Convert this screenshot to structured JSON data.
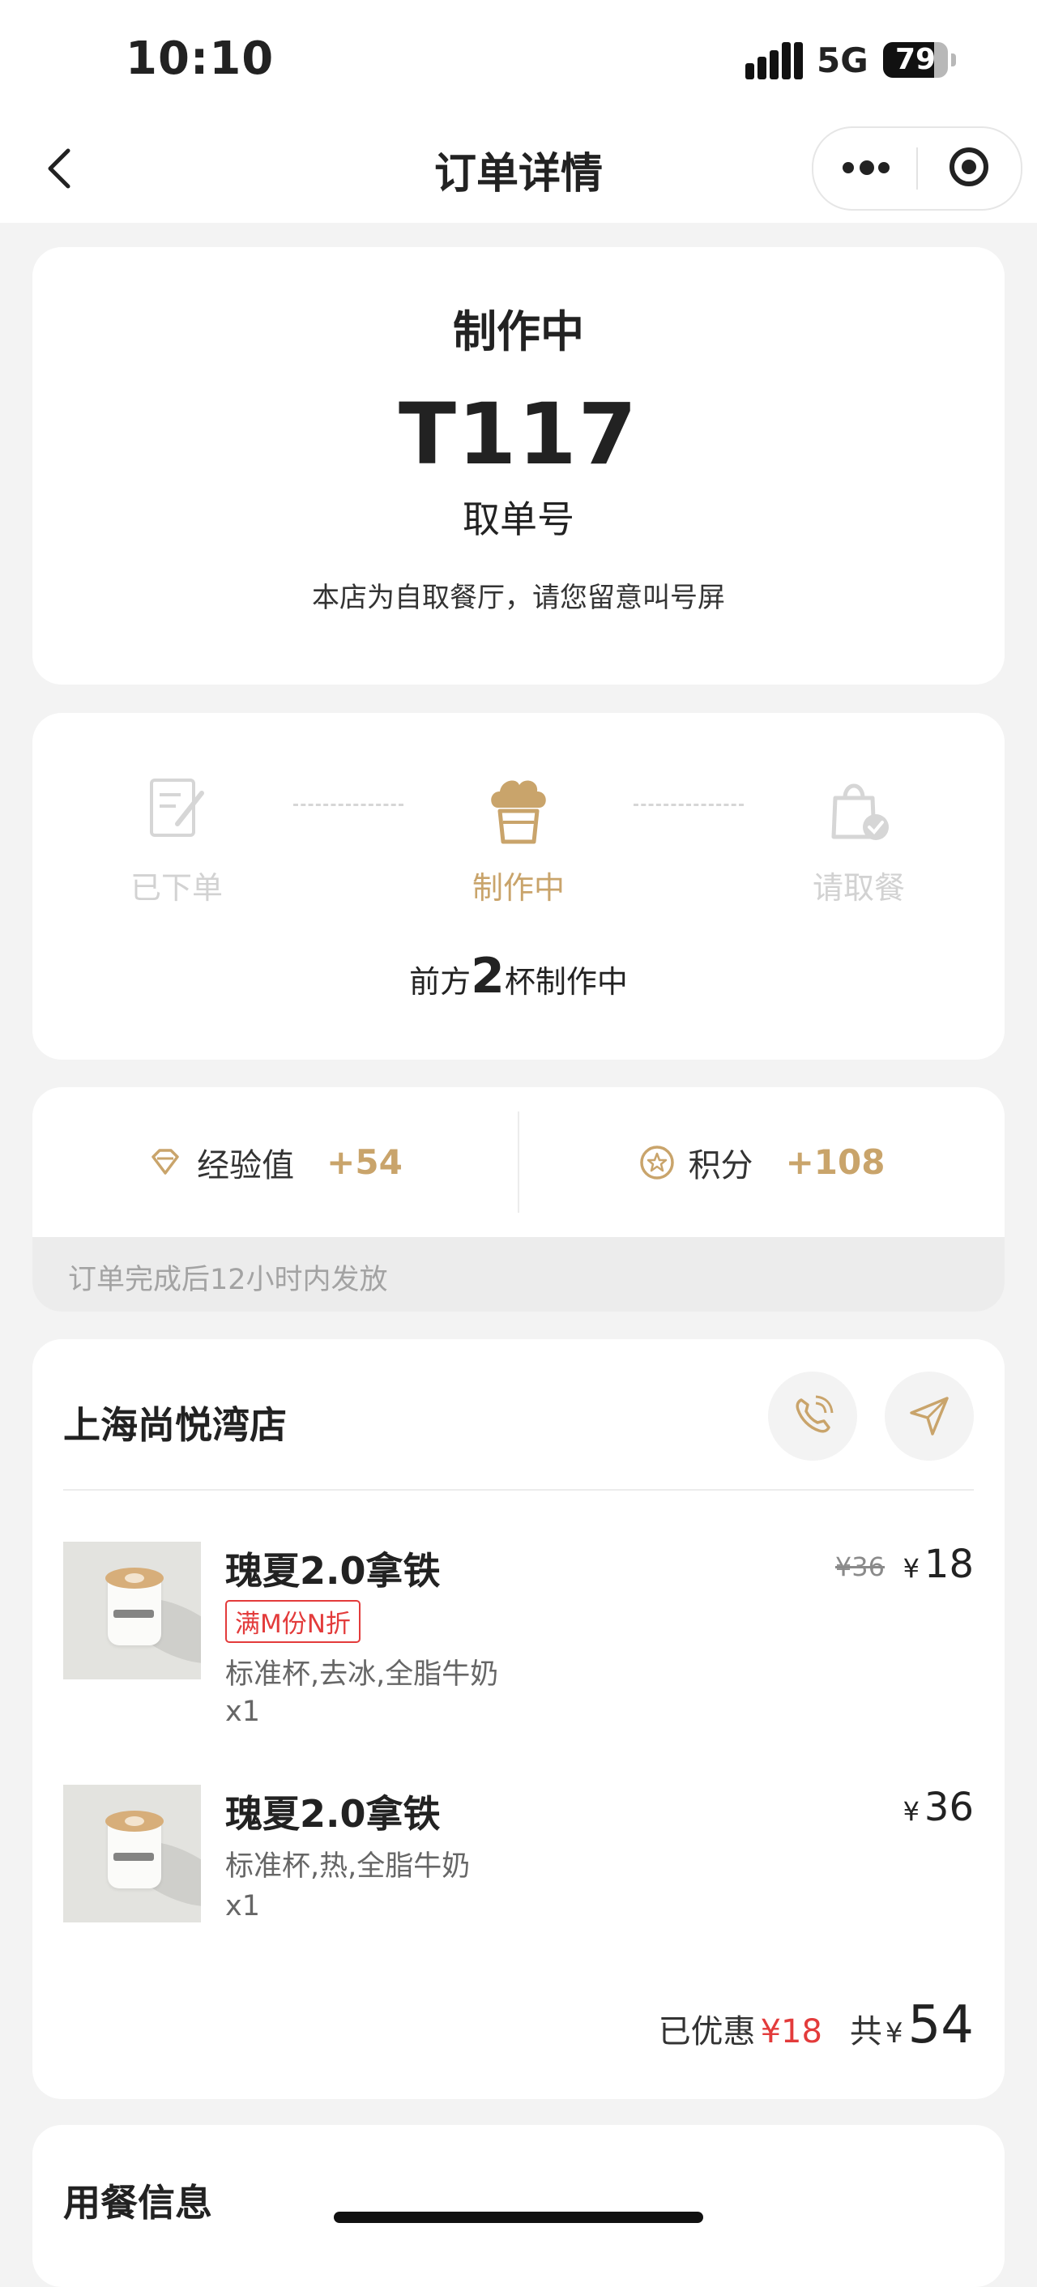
{
  "status_bar": {
    "time": "10:10",
    "network": "5G",
    "battery": "79",
    "battery_level_percent": 79
  },
  "nav": {
    "title": "订单详情",
    "back_icon": "chevron-left-icon",
    "more_icon": "more-dots-icon",
    "close_icon": "target-icon"
  },
  "order_status": {
    "title": "制作中",
    "pickup_number": "T117",
    "pickup_label": "取单号",
    "notice": "本店为自取餐厅，请您留意叫号屏"
  },
  "progress": {
    "steps": [
      {
        "label": "已下单",
        "icon": "order-note-icon",
        "state": "done"
      },
      {
        "label": "制作中",
        "icon": "chef-hat-icon",
        "state": "active"
      },
      {
        "label": "请取餐",
        "icon": "shopping-bag-icon",
        "state": "todo"
      }
    ],
    "queue_prefix": "前方",
    "queue_count": "2",
    "queue_suffix": "杯制作中"
  },
  "rewards": {
    "exp_label": "经验值",
    "exp_value": "+54",
    "points_label": "积分",
    "points_value": "+108",
    "note": "订单完成后12小时内发放"
  },
  "store": {
    "name": "上海尚悦湾店",
    "call_icon": "phone-icon",
    "nav_icon": "navigation-arrow-icon"
  },
  "items": [
    {
      "name": "瑰夏2.0拿铁",
      "promo": "满M份N折",
      "spec": "标准杯,去冰,全脂牛奶",
      "qty": "x1",
      "original_price": "¥36",
      "currency": "¥",
      "price": "18"
    },
    {
      "name": "瑰夏2.0拿铁",
      "spec": "标准杯,热,全脂牛奶",
      "qty": "x1",
      "currency": "¥",
      "price": "36"
    }
  ],
  "totals": {
    "discount_label": "已优惠",
    "discount_value": "¥18",
    "total_label": "共",
    "currency": "¥",
    "total_value": "54"
  },
  "meal_info": {
    "title": "用餐信息"
  },
  "colors": {
    "accent": "#c9a46b",
    "discount_red": "#e33b3b",
    "background": "#f3f3f3"
  }
}
